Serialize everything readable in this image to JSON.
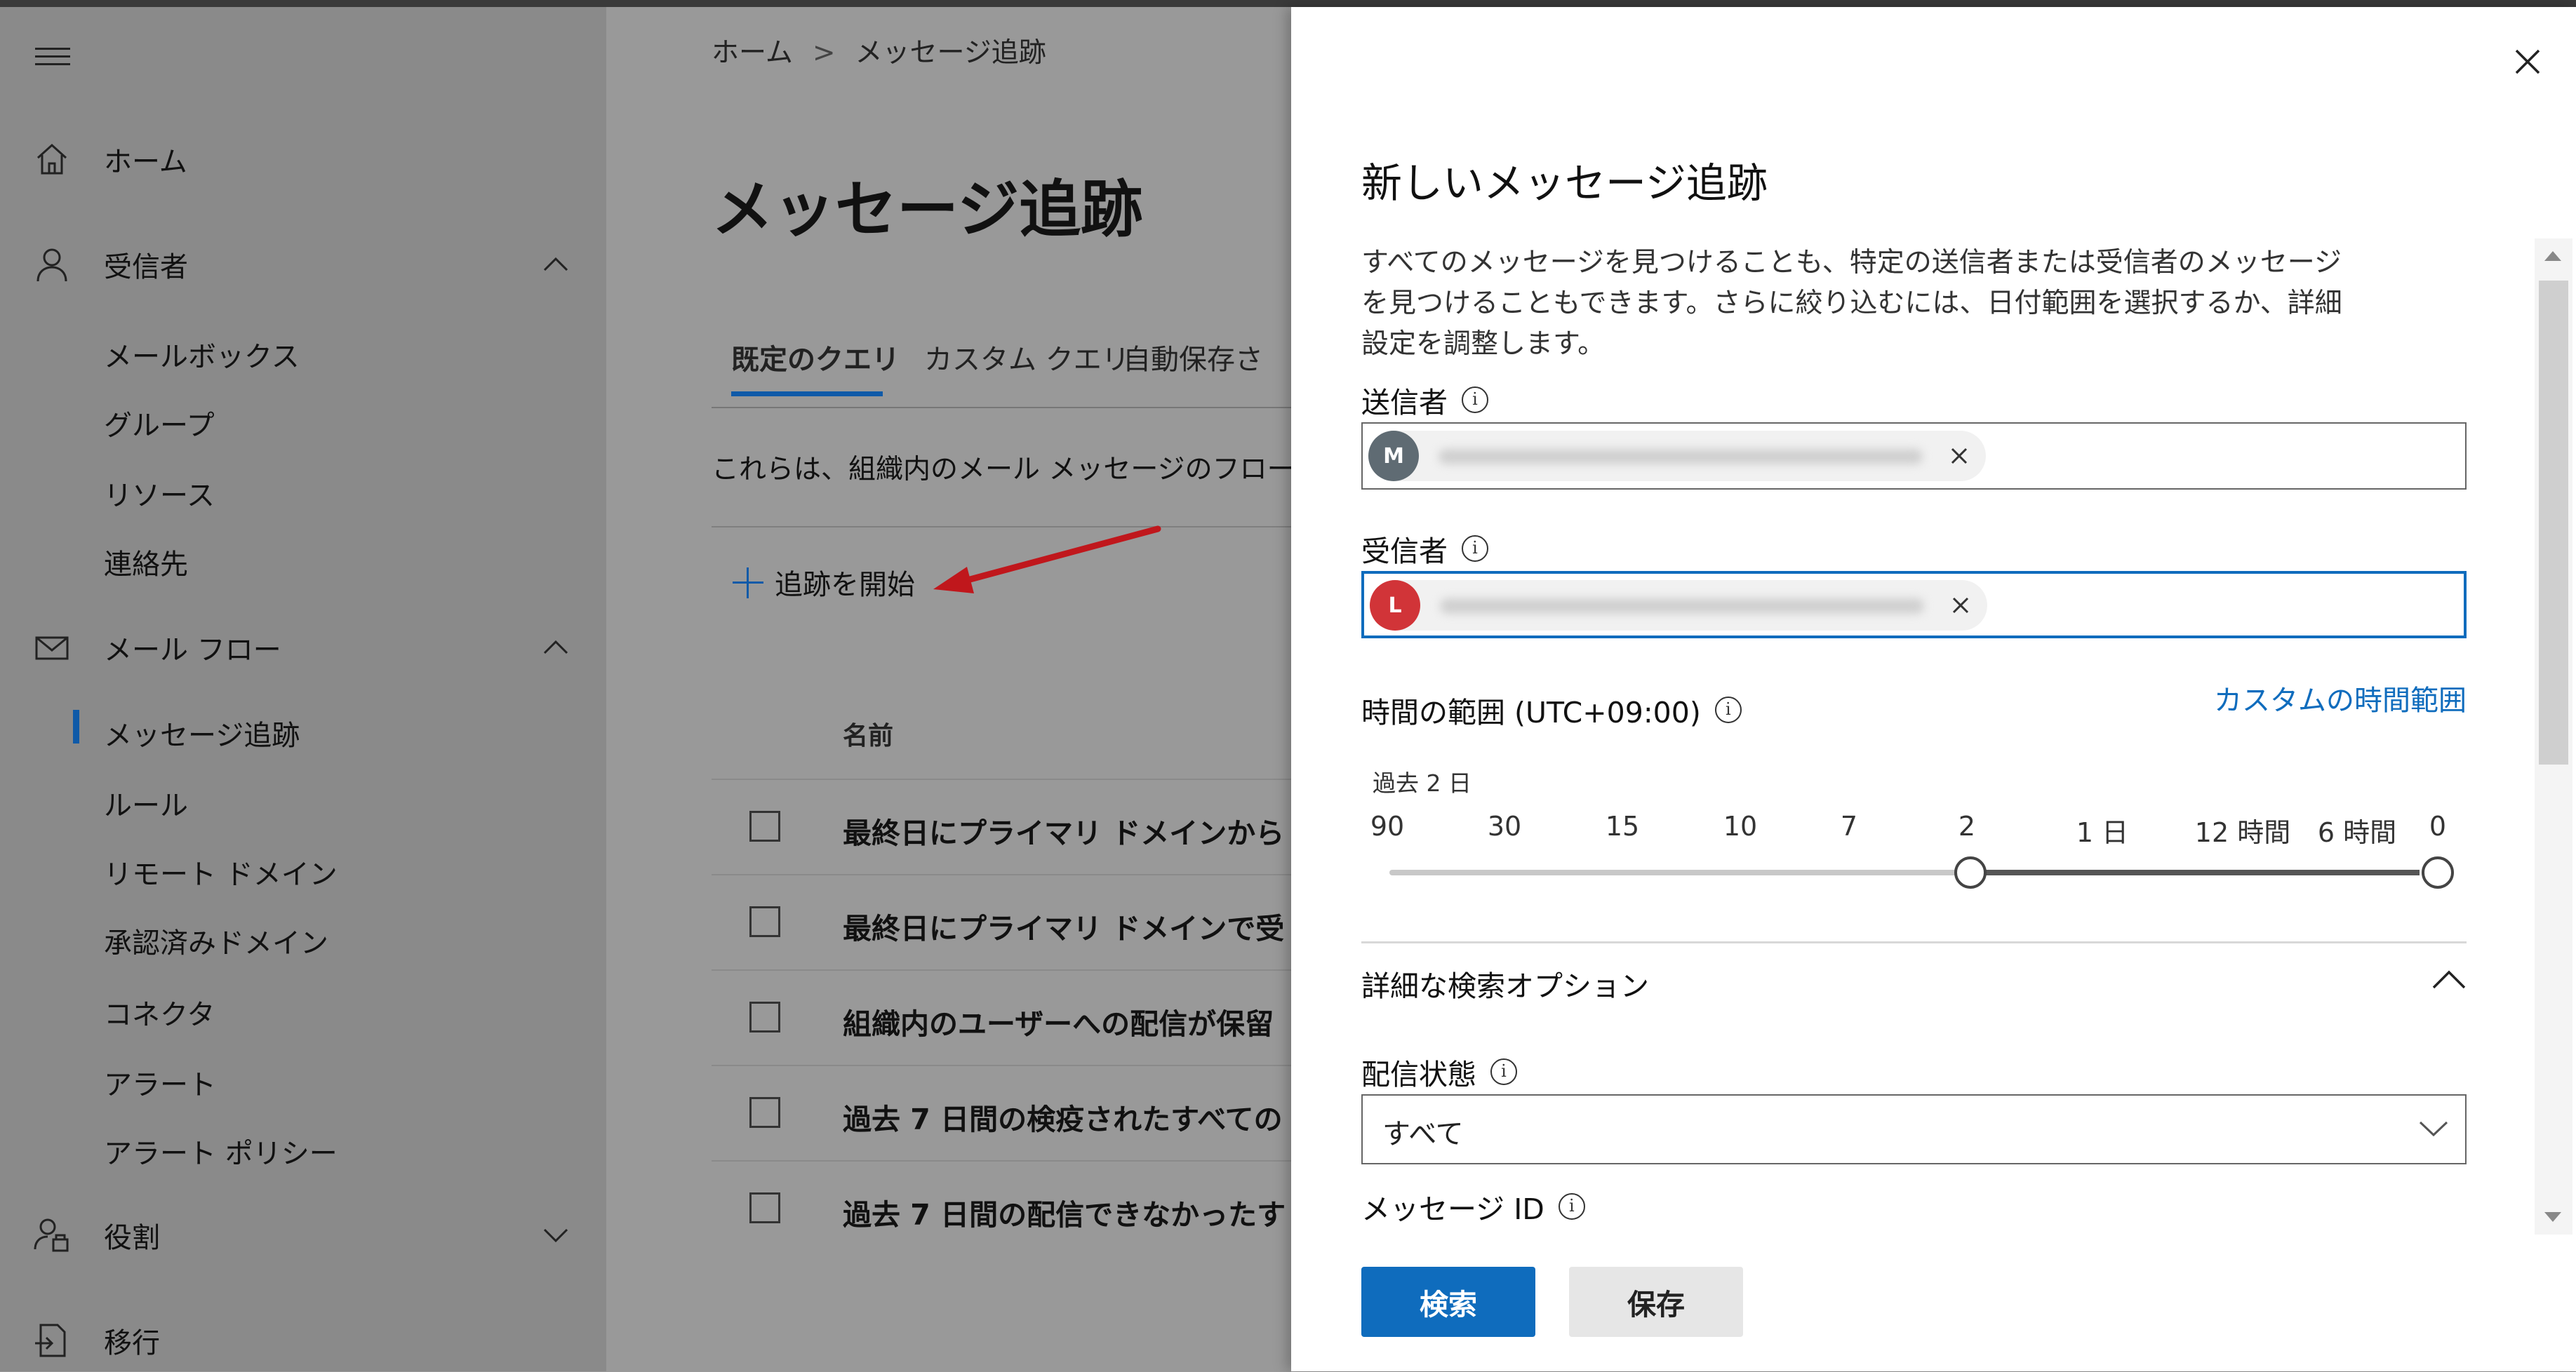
{
  "nav": {
    "items": [
      {
        "label": "ホーム",
        "icon": "home-icon"
      },
      {
        "label": "受信者",
        "icon": "person-icon"
      },
      {
        "label": "メール フロー",
        "icon": "mail-icon"
      },
      {
        "label": "役割",
        "icon": "roles-icon"
      },
      {
        "label": "移行",
        "icon": "migration-icon"
      }
    ],
    "recipients_sub": [
      "メールボックス",
      "グループ",
      "リソース",
      "連絡先"
    ],
    "mailflow_sub": [
      "メッセージ追跡",
      "ルール",
      "リモート ドメイン",
      "承認済みドメイン",
      "コネクタ",
      "アラート",
      "アラート ポリシー"
    ]
  },
  "main": {
    "breadcrumb": [
      "ホーム",
      "メッセージ追跡"
    ],
    "title": "メッセージ追跡",
    "tabs": [
      "既定のクエリ",
      "カスタム クエリ",
      "自動保存さ"
    ],
    "description": "これらは、組織内のメール メッセージのフローを追跡",
    "start_trace": "追跡を開始",
    "column_name": "名前",
    "rows": [
      "最終日にプライマリ ドメインから",
      "最終日にプライマリ ドメインで受",
      "組織内のユーザーへの配信が保留",
      "過去 7 日間の検疫されたすべての",
      "過去 7 日間の配信できなかったす"
    ]
  },
  "panel": {
    "title": "新しいメッセージ追跡",
    "description": "すべてのメッセージを見つけることも、特定の送信者または受信者のメッセージを見つけることもできます。さらに絞り込むには、日付範囲を選択するか、詳細設定を調整します。",
    "sender_label": "送信者",
    "sender_avatar": "M",
    "sender_avatar_color": "#5f6b73",
    "recipient_label": "受信者",
    "recipient_avatar": "L",
    "recipient_avatar_color": "#d13438",
    "time_range_label": "時間の範囲 (UTC+09:00)",
    "custom_range_link": "カスタムの時間範囲",
    "range_selected": "過去 2 日",
    "ticks": [
      "90",
      "30",
      "15",
      "10",
      "7",
      "2",
      "1 日",
      "12 時間",
      "6 時間",
      "0"
    ],
    "advanced_options": "詳細な検索オプション",
    "delivery_status_label": "配信状態",
    "delivery_status_value": "すべて",
    "message_id_label": "メッセージ ID",
    "search_button": "検索",
    "save_button": "保存",
    "accent_color": "#0f6cbd"
  }
}
